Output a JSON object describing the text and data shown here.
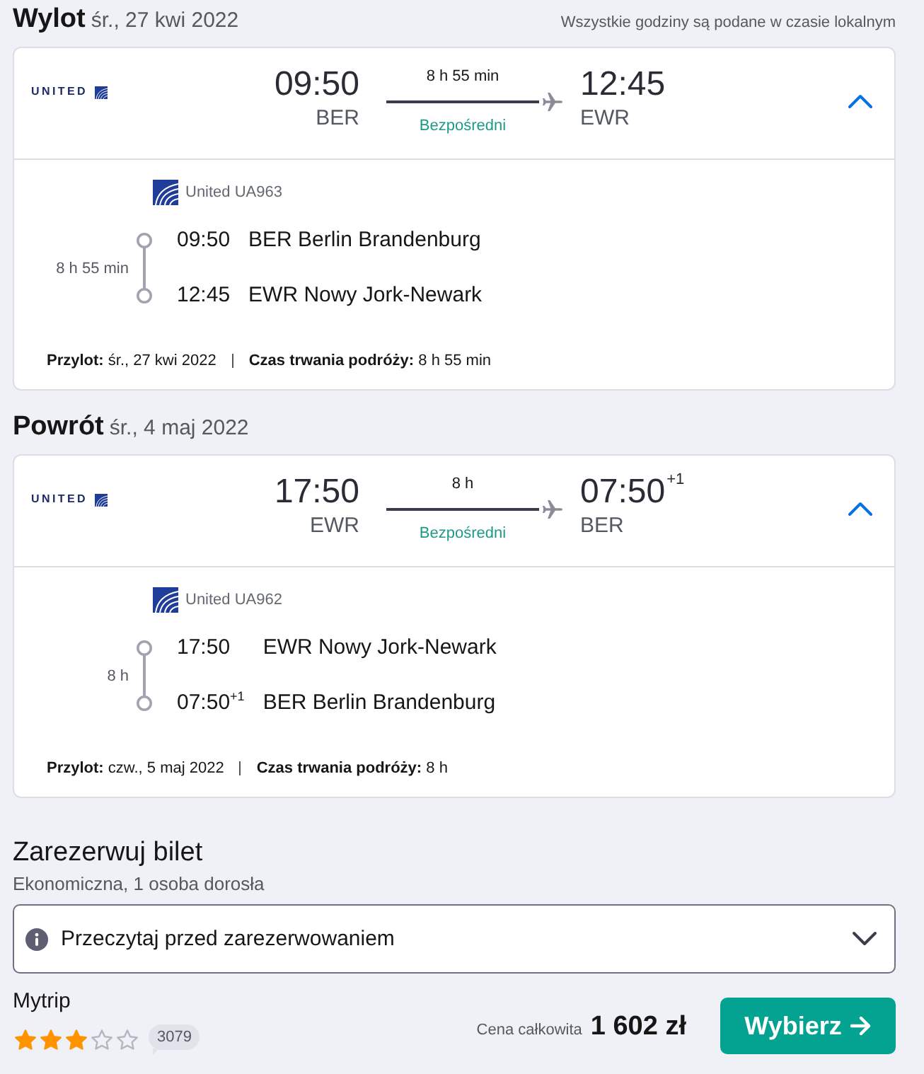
{
  "legs": [
    {
      "title": "Wylot",
      "date": "śr., 27 kwi 2022",
      "note": "Wszystkie godziny są podane w czasie lokalnym",
      "expanded": true,
      "airline_logo": "UNITED",
      "departure": {
        "time": "09:50",
        "airport": "BER"
      },
      "duration": "8 h 55 min",
      "stops_label": "Bezpośredni",
      "arrival": {
        "time": "12:45",
        "airport": "EWR"
      },
      "segment": {
        "flight": "United UA963",
        "duration": "8 h 55 min",
        "stops": [
          {
            "time": "09:50",
            "airport": "BER Berlin Brandenburg"
          },
          {
            "time": "12:45",
            "airport": "EWR Nowy Jork-Newark"
          }
        ]
      },
      "footer": {
        "arrival": "**Przylot:** śr., 27 kwi 2022",
        "trip_duration": "**Czas trwania podróży:** 8 h 55 min"
      }
    },
    {
      "title": "Powrót",
      "date": "śr., 4 maj 2022",
      "expanded": true,
      "airline_logo": "UNITED",
      "departure": {
        "time": "17:50",
        "airport": "EWR"
      },
      "duration": "8 h",
      "stops_label": "Bezpośredni",
      "arrival": {
        "time": "07:50$^{+1}$",
        "airport": "BER"
      },
      "segment": {
        "flight": "United UA962",
        "duration": "8 h",
        "stops": [
          {
            "time": "17:50",
            "airport": "EWR Nowy Jork-Newark"
          },
          {
            "time": "07:50$^{+1}$",
            "airport": "BER Berlin Brandenburg"
          }
        ]
      },
      "footer": {
        "arrival": "**Przylot:** czw., 5 maj 2022",
        "trip_duration": "**Czas trwania podróży:** 8 h"
      }
    }
  ],
  "booking": {
    "title": "Zarezerwuj bilet",
    "subtitle": "Ekonomiczna, 1 osoba dorosła",
    "notice": {
      "label": "Przeczytaj przed zarezerwowaniem",
      "expanded": false
    },
    "provider": {
      "name": "Mytrip",
      "stars": 3,
      "reviews": "3079"
    },
    "price_label": "Cena całkowita",
    "price": "1 602 zł",
    "button": "Wybierz"
  }
}
